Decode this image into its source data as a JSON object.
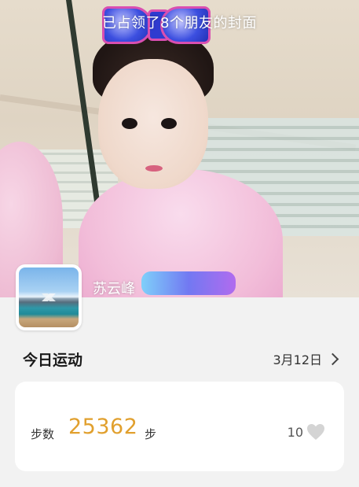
{
  "cover": {
    "caption": "已占领了8个朋友的封面"
  },
  "profile": {
    "username": "苏云峰"
  },
  "today": {
    "title": "今日运动",
    "date": "3月12日"
  },
  "steps": {
    "label": "步数",
    "value": "25362",
    "unit": "步"
  },
  "likes": {
    "count": "10",
    "icon": "heart-icon"
  },
  "colors": {
    "accent": "#e1a02e",
    "heart": "#d4d4d4",
    "background": "#f2f2f2"
  }
}
